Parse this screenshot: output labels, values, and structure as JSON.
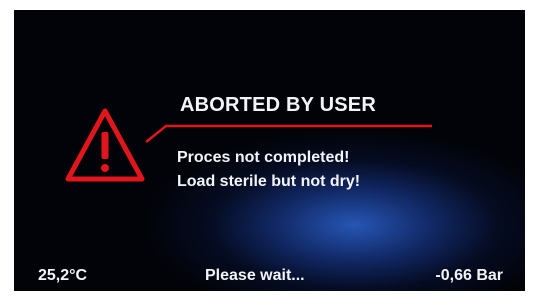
{
  "alert": {
    "title": "ABORTED BY USER",
    "lines": [
      "Proces not completed!",
      "Load sterile but not dry!"
    ],
    "icon": "warning-triangle-icon"
  },
  "footer": {
    "temperature": "25,2°C",
    "status": "Please wait...",
    "pressure": "-0,66 Bar"
  },
  "colors": {
    "background": "#020308",
    "glow": "#1e4ab0",
    "accent_red": "#e0161c",
    "text": "#f2f4f8"
  }
}
